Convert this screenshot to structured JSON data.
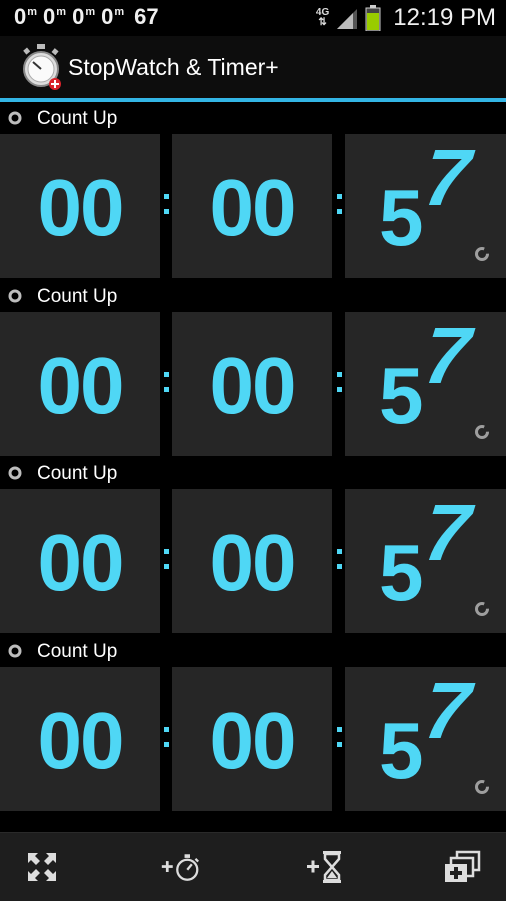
{
  "status_bar": {
    "notifications": [
      {
        "value": "0",
        "suffix": "m"
      },
      {
        "value": "0",
        "suffix": "m"
      },
      {
        "value": "0",
        "suffix": "m"
      },
      {
        "value": "0",
        "suffix": "m"
      }
    ],
    "count": "67",
    "network": "4G",
    "time": "12:19 PM"
  },
  "app": {
    "title": "StopWatch & Timer+"
  },
  "timers": [
    {
      "label": "Count Up",
      "hours": "00",
      "minutes": "00",
      "sec_tens": "5",
      "sec_ones": "7"
    },
    {
      "label": "Count Up",
      "hours": "00",
      "minutes": "00",
      "sec_tens": "5",
      "sec_ones": "7"
    },
    {
      "label": "Count Up",
      "hours": "00",
      "minutes": "00",
      "sec_tens": "5",
      "sec_ones": "7"
    },
    {
      "label": "Count Up",
      "hours": "00",
      "minutes": "00",
      "sec_tens": "5",
      "sec_ones": "7"
    }
  ],
  "actions": [
    {
      "icon": "expand-icon"
    },
    {
      "icon": "add-stopwatch-icon"
    },
    {
      "icon": "add-timer-icon"
    },
    {
      "icon": "add-window-icon"
    }
  ],
  "colors": {
    "accent": "#33b5e5",
    "digits": "#4fd7f5",
    "cell_bg": "#262626"
  }
}
